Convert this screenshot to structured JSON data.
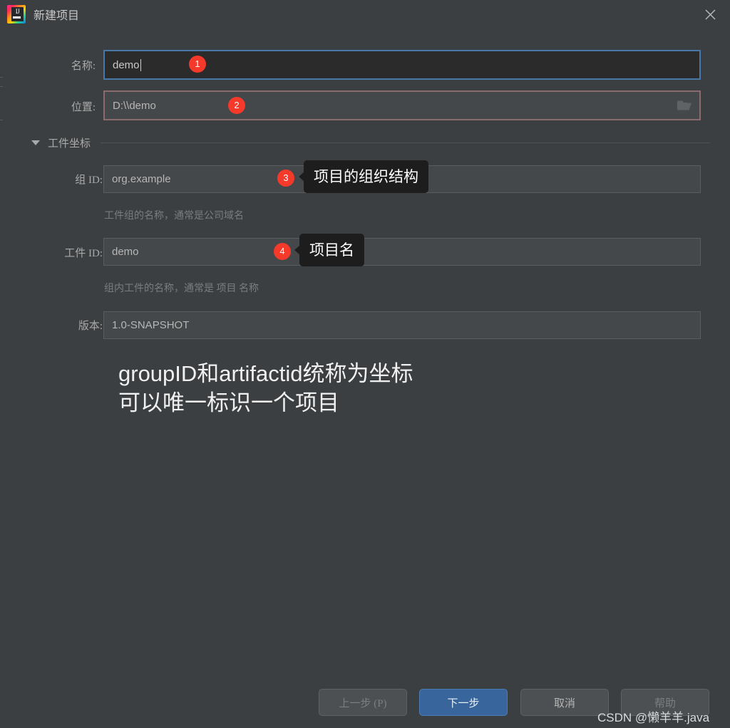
{
  "window": {
    "title": "新建项目",
    "app_icon": "intellij-idea-icon",
    "icon_glyph": "IJ",
    "close_icon": "close-icon",
    "bg_color": "#3c3f41"
  },
  "form": {
    "name": {
      "label": "名称:",
      "value": "demo",
      "focused": true,
      "focus_border_color": "#4878a8"
    },
    "location": {
      "label": "位置:",
      "value": "D:\\\\demo",
      "browse_icon": "folder-icon",
      "highlight_border_color": "#8d6a6d"
    },
    "section": {
      "label": "工件坐标",
      "expanded": true,
      "chevron_icon": "triangle-down-icon"
    },
    "group_id": {
      "label": "组 ID:",
      "value": "org.example",
      "hint": "工件组的名称，通常是公司域名"
    },
    "artifact_id": {
      "label": "工件 ID:",
      "value": "demo",
      "hint": "组内工件的名称，通常是 项目 名称"
    },
    "version": {
      "label": "版本:",
      "value": "1.0-SNAPSHOT"
    }
  },
  "badges": [
    {
      "number": "1",
      "color": "#f5392b"
    },
    {
      "number": "2",
      "color": "#f5392b"
    },
    {
      "number": "3",
      "color": "#f5392b"
    },
    {
      "number": "4",
      "color": "#f5392b"
    }
  ],
  "tooltips": [
    {
      "text": "项目的组织结构"
    },
    {
      "text": "项目名"
    }
  ],
  "annotation": {
    "line1": "groupID和artifactid统称为坐标",
    "line2": "可以唯一标识一个项目"
  },
  "footer": {
    "prev_label": "上一步 (P)",
    "next_label": "下一步",
    "cancel_label": "取消",
    "help_label": "帮助",
    "primary_color": "#37659c"
  },
  "watermark": "CSDN @懒羊羊.java"
}
